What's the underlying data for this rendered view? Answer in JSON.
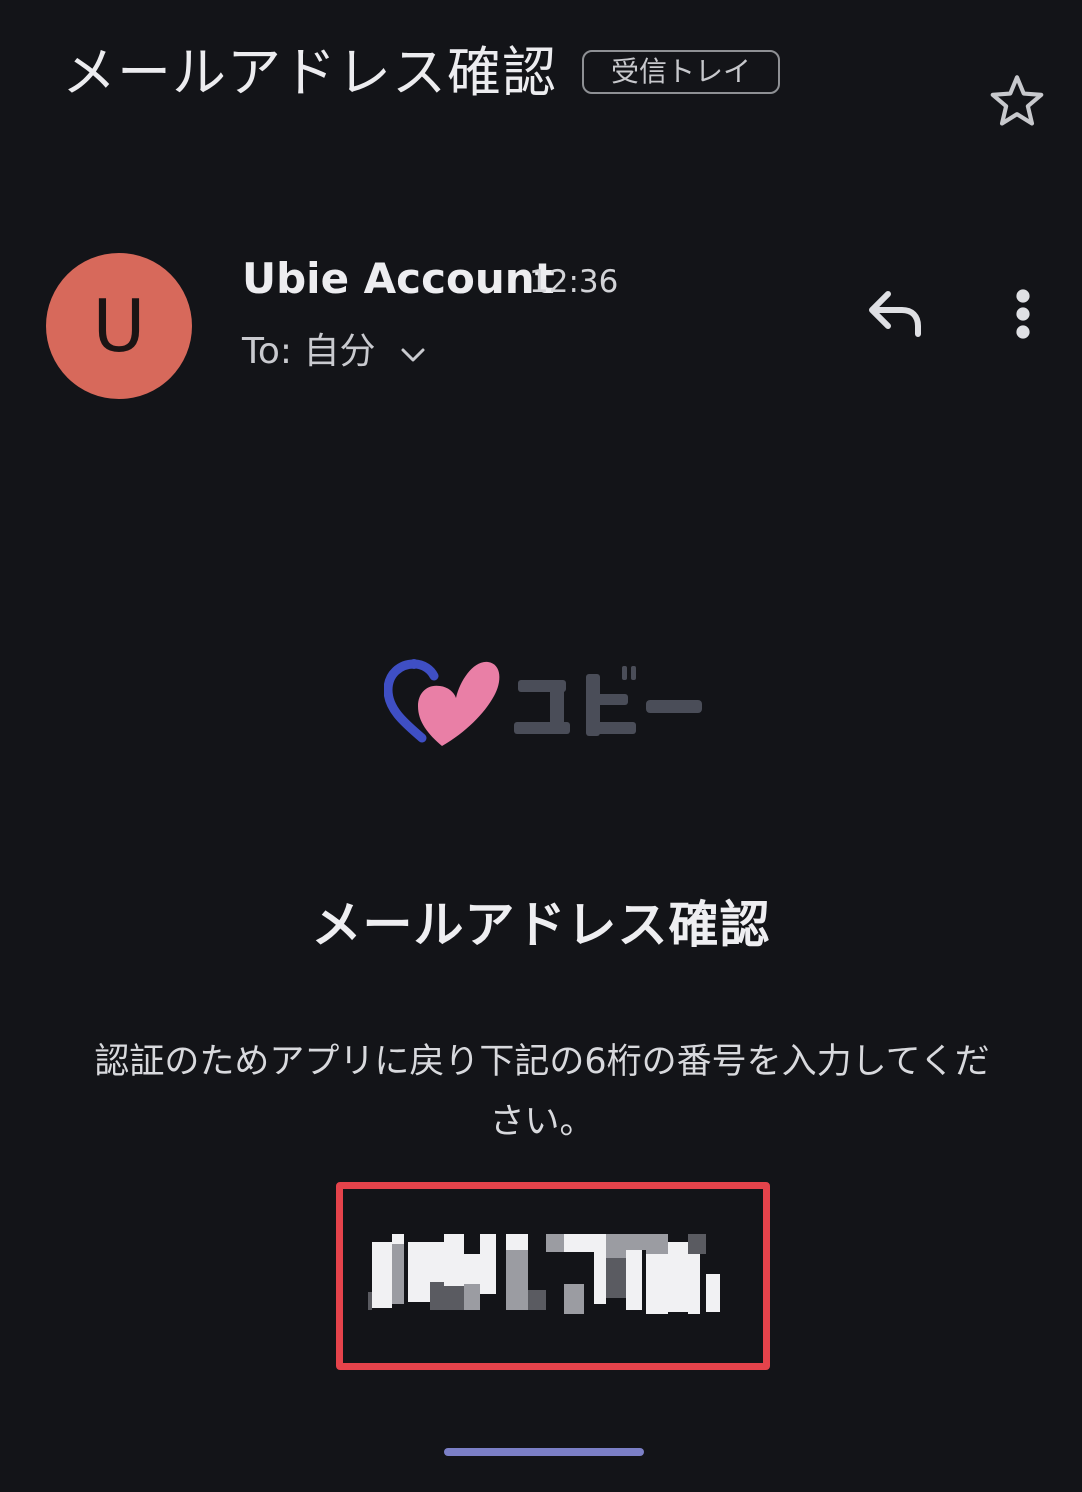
{
  "header": {
    "subject": "メールアドレス確認",
    "label_chip": "受信トレイ",
    "star_icon": "star-outline-icon"
  },
  "sender": {
    "avatar_letter": "U",
    "avatar_color": "#d7695b",
    "name": "Ubie Account",
    "time": "12:36",
    "to_label": "To: 自分",
    "expand_icon": "chevron-down-icon",
    "reply_icon": "reply-icon",
    "more_icon": "more-vert-icon"
  },
  "body": {
    "logo_icon": "ubie-heart-logo",
    "heading": "メールアドレス確認",
    "instruction": "認証のためアプリに戻り下記の6桁の番号を入力してください。",
    "highlight_color": "#e5434b"
  }
}
